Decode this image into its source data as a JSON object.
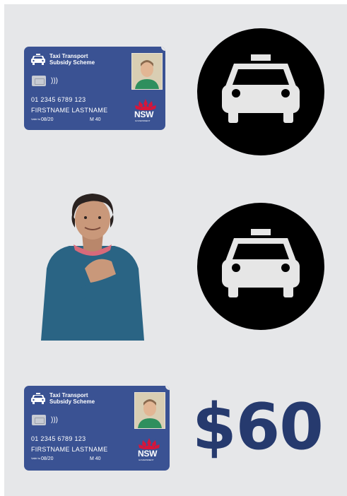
{
  "card": {
    "title": "Taxi Transport\nSubsidy Scheme",
    "number": "01 2345 6789 123",
    "name": "FIRSTNAME LASTNAME",
    "valid_label": "Valid to",
    "expiry": "08/20",
    "code": "M 40",
    "logo_text": "NSW",
    "logo_sub": "GOVERNMENT"
  },
  "price": "$60",
  "colors": {
    "background": "#e6e7e9",
    "card_blue": "#3a5293",
    "price_navy": "#263a6e",
    "waratah_red": "#d7153a"
  },
  "icons": [
    "taxi-icon",
    "waratah-logo-icon",
    "contactless-icon",
    "chip-icon"
  ]
}
